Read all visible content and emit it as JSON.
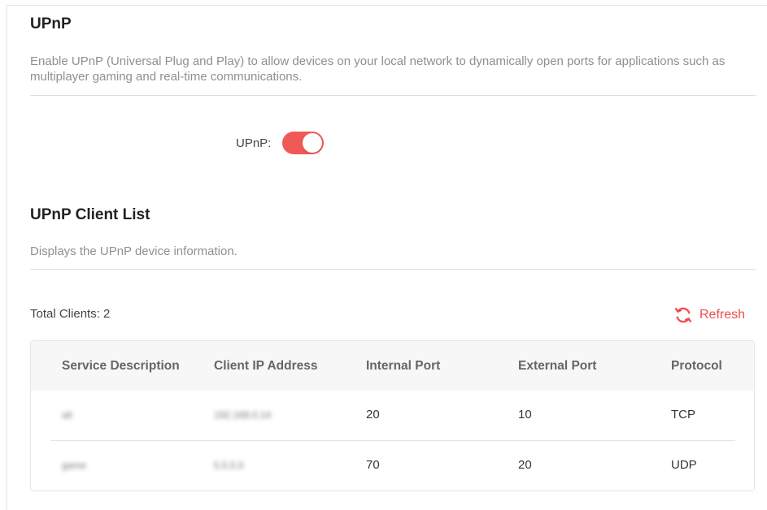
{
  "upnp": {
    "title": "UPnP",
    "description": "Enable UPnP (Universal Plug and Play) to allow devices on your local network to dynamically open ports for applications such as multiplayer gaming and real-time communications.",
    "toggle_label": "UPnP:",
    "enabled": true,
    "toggle_color": "#ef5a57"
  },
  "client_list": {
    "title": "UPnP Client List",
    "description": "Displays the UPnP device information.",
    "total_clients": "Total Clients: 2",
    "refresh_label": "Refresh",
    "refresh_icon": "refresh-icon",
    "accent_color": "#ef4e4e",
    "columns": [
      "Service Description",
      "Client IP Address",
      "Internal Port",
      "External Port",
      "Protocol"
    ],
    "rows": [
      {
        "service": "alt",
        "ip": "192.168.0.14",
        "internal": "20",
        "external": "10",
        "protocol": "TCP"
      },
      {
        "service": "game",
        "ip": "5.5.5.5",
        "internal": "70",
        "external": "20",
        "protocol": "UDP"
      }
    ]
  }
}
